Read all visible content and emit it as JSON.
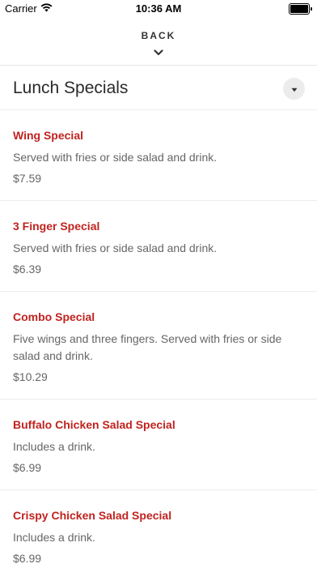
{
  "status_bar": {
    "carrier": "Carrier",
    "time": "10:36 AM",
    "battery_level": 1.0
  },
  "header": {
    "back_label": "BACK",
    "back_icon": "chevron-down-icon"
  },
  "section": {
    "title": "Lunch Specials",
    "toggle_icon": "caret-down-icon"
  },
  "menu": {
    "items": [
      {
        "name": "Wing Special",
        "description": "Served with fries or side salad and drink.",
        "price": "$7.59"
      },
      {
        "name": "3 Finger Special",
        "description": "Served with fries or side salad and drink.",
        "price": "$6.39"
      },
      {
        "name": "Combo Special",
        "description": "Five wings and three fingers. Served with fries or side salad and drink.",
        "price": "$10.29"
      },
      {
        "name": "Buffalo Chicken Salad Special",
        "description": "Includes a drink.",
        "price": "$6.99"
      },
      {
        "name": "Crispy Chicken Salad Special",
        "description": "Includes a drink.",
        "price": "$6.99"
      }
    ]
  },
  "colors": {
    "item_name": "#c0231f",
    "text_muted": "#666666",
    "divider": "#ececec"
  }
}
